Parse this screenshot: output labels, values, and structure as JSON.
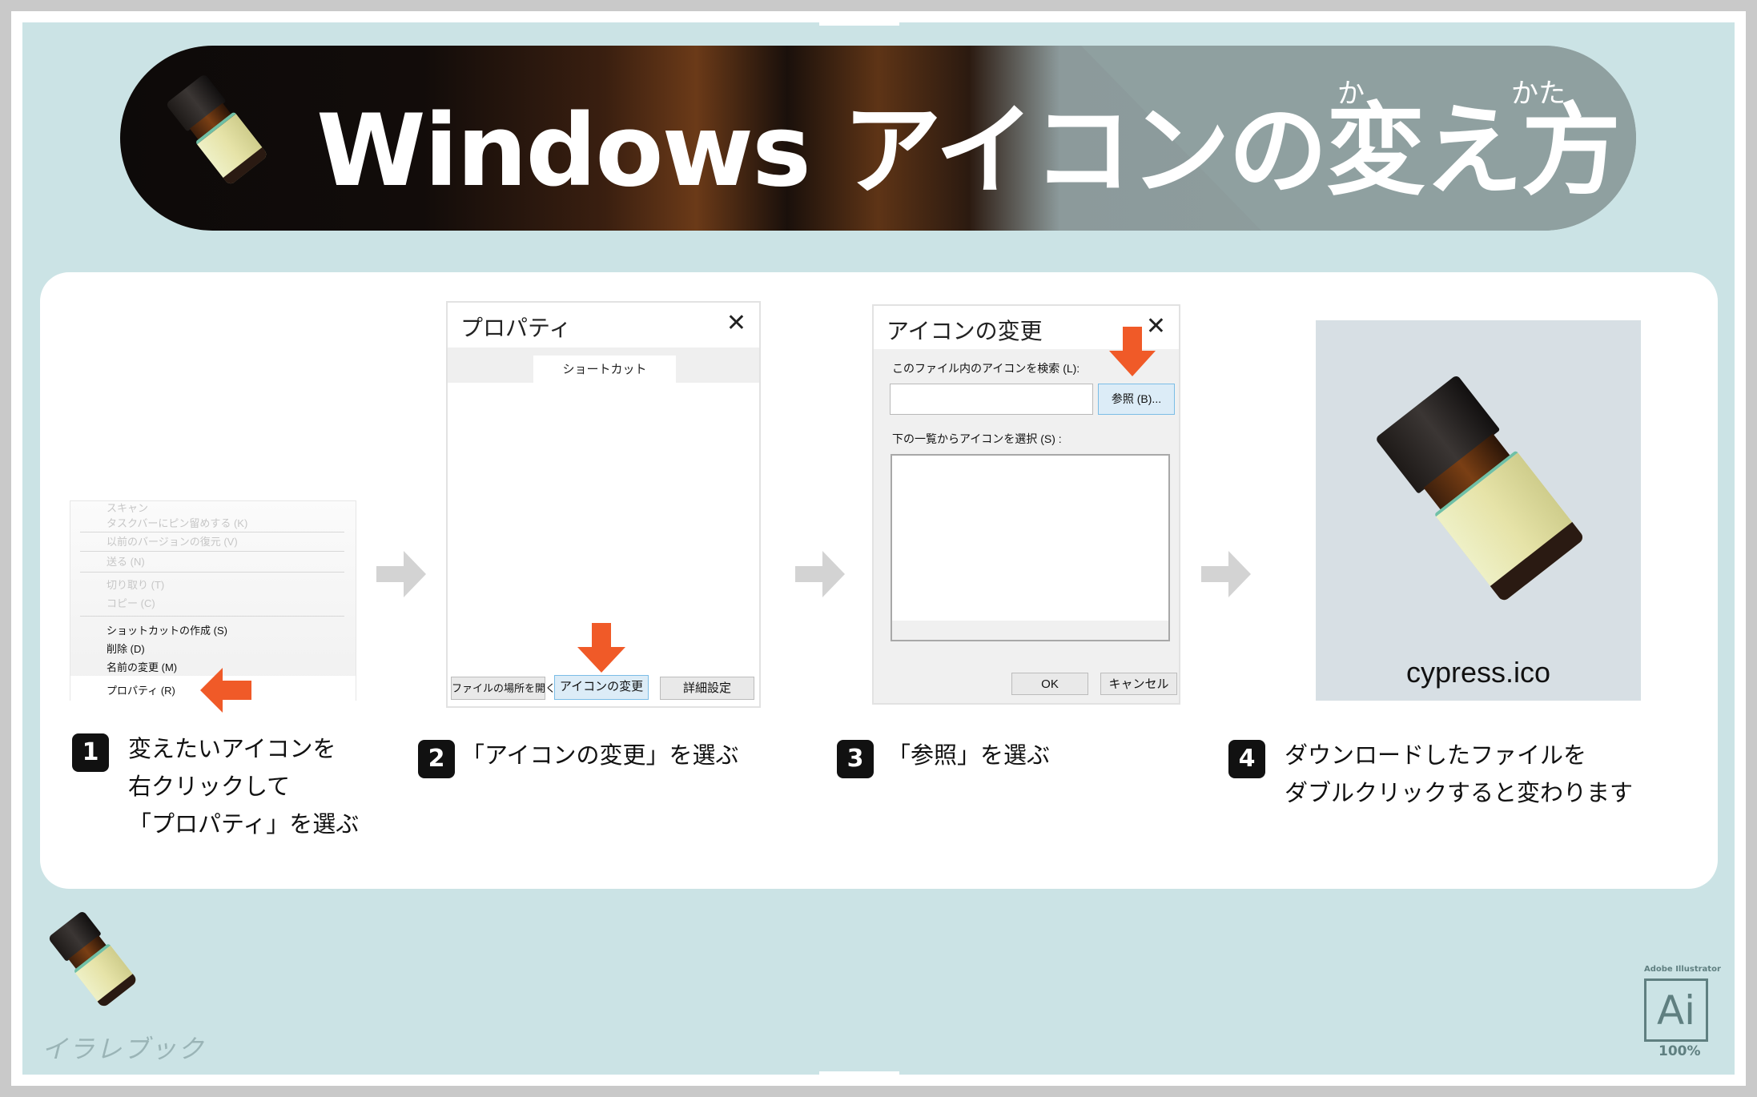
{
  "header": {
    "title": "Windows アイコンの変え方",
    "ruby_ka": "か",
    "ruby_kata": "かた"
  },
  "context_menu": {
    "items": [
      {
        "label": "スキャン",
        "dimmed": true
      },
      {
        "label": "タスクバーにピン留めする (K)",
        "dimmed": true
      },
      {
        "label": "以前のバージョンの復元 (V)",
        "dimmed": true
      },
      {
        "label": "送る (N)",
        "dimmed": true
      },
      {
        "label": "切り取り (T)",
        "dimmed": true
      },
      {
        "label": "コピー (C)",
        "dimmed": true
      },
      {
        "label": "ショットカットの作成 (S)",
        "dimmed": false
      },
      {
        "label": "削除 (D)",
        "dimmed": false
      },
      {
        "label": "名前の変更 (M)",
        "dimmed": false
      },
      {
        "label": "プロパティ (R)",
        "dimmed": false,
        "selected": true
      }
    ]
  },
  "properties_dialog": {
    "title": "プロパティ",
    "close": "✕",
    "tab": "ショートカット",
    "buttons": {
      "open_location": "ファイルの場所を開く",
      "change_icon": "アイコンの変更",
      "advanced": "詳細設定"
    }
  },
  "change_icon_dialog": {
    "title": "アイコンの変更",
    "close": "✕",
    "search_label": "このファイル内のアイコンを検索 (L):",
    "path_value": "",
    "browse": "参照 (B)...",
    "list_label": "下の一覧からアイコンを選択 (S) :",
    "ok": "OK",
    "cancel": "キャンセル"
  },
  "icon_preview": {
    "filename": "cypress.ico"
  },
  "steps": [
    {
      "number": "1",
      "lines": [
        "変えたいアイコンを",
        "右クリックして",
        "「プロパティ」を選ぶ"
      ]
    },
    {
      "number": "2",
      "lines": [
        "「アイコンの変更」を選ぶ"
      ]
    },
    {
      "number": "3",
      "lines": [
        "「参照」を選ぶ"
      ]
    },
    {
      "number": "4",
      "lines": [
        "ダウンロードしたファイルを",
        "ダブルクリックすると変わります"
      ]
    }
  ],
  "footer": {
    "brand": "イラレブック",
    "ai_caption": "Adobe Illustrator",
    "ai_label": "Ai",
    "ai_zoom": "100%"
  },
  "colors": {
    "background": "#cbe3e5",
    "accent_orange": "#f05a28",
    "step_arrow": "#d3d3d3",
    "highlight_button": "#dcecf7"
  }
}
